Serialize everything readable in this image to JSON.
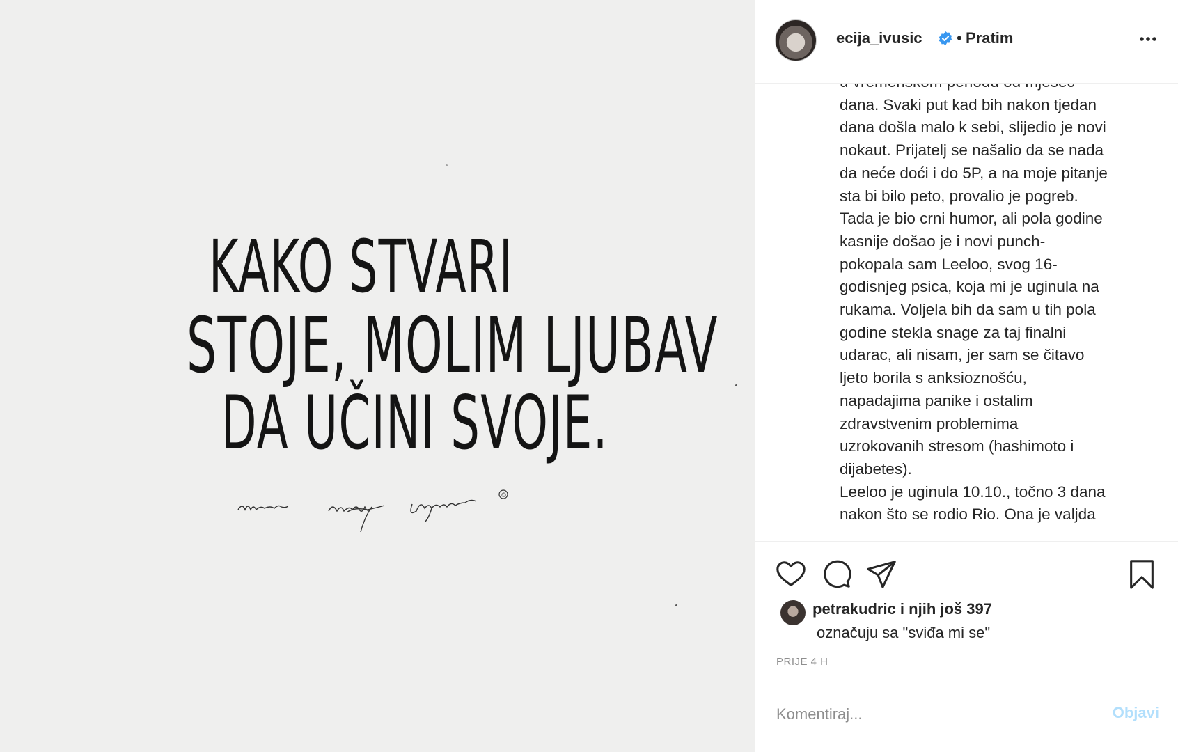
{
  "media": {
    "quote_lines": [
      "KAKO  STVARI",
      "STOJE, MOLIM LJUBAV",
      "DA UČINI SVOJE."
    ],
    "signature_symbol": "©"
  },
  "header": {
    "username": "ecija_ivusic",
    "separator": "•",
    "follow_label": "Pratim",
    "verified_color": "#3897f0"
  },
  "caption": {
    "text": "u vremenskom periodu od mjesec\ndana. Svaki put kad bih nakon tjedan\ndana došla malo k sebi, slijedio je novi\nnokaut. Prijatelj se našalio da se nada\nda neće doći i do 5P, a na moje pitanje\nsta bi bilo peto, provalio je pogreb.\nTada je bio crni humor, ali pola godine\nkasnije došao je i novi punch-\npokopala sam Leeloo, svog 16-\ngodisnjeg psica, koja mi je uginula na\nrukama. Voljela bih da sam u tih pola\ngodine stekla snage za taj finalni\nudarac, ali nisam, jer sam se čitavo\nljeto borila s anksioznošću,\nnapadajima panike i ostalim\nzdravstvenim problemima\nuzrokovanih stresom (hashimoto i\ndijabetes).\nLeeloo je uginula 10.10., točno 3 dana\nnakon što se rodio Rio. Ona je valjda"
  },
  "actions": {
    "icons": [
      "heart-icon",
      "comment-icon",
      "share-icon",
      "bookmark-icon"
    ]
  },
  "likes": {
    "line1": "petrakudric i njih još 397",
    "line2": "označuju sa \"sviđa mi se\""
  },
  "timestamp": "PRIJE 4 H",
  "comment": {
    "placeholder": "Komentiraj...",
    "post_label": "Objavi",
    "post_color": "#b2dffc"
  }
}
